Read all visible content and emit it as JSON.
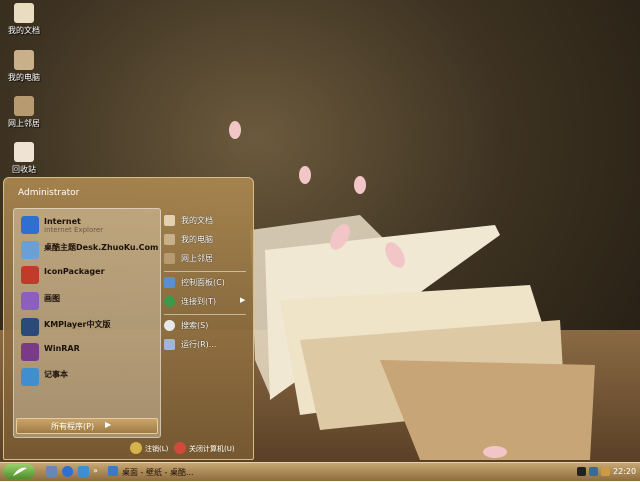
{
  "desktop": {
    "icons": [
      {
        "label": "我的文档",
        "icon": "my-documents-icon"
      },
      {
        "label": "我的电脑",
        "icon": "my-computer-icon"
      },
      {
        "label": "网上邻居",
        "icon": "network-icon"
      },
      {
        "label": "回收站",
        "icon": "recycle-bin-icon"
      }
    ]
  },
  "start_menu": {
    "user": "Administrator",
    "pinned": [
      {
        "name": "Internet",
        "sub": "Internet Explorer",
        "icon": "ie-icon"
      },
      {
        "name": "桌酷主题Desk.ZhuoKu.Com",
        "sub": "",
        "icon": "zhuoku-icon"
      },
      {
        "name": "IconPackager",
        "sub": "",
        "icon": "iconpackager-icon"
      },
      {
        "name": "画图",
        "sub": "",
        "icon": "paint-icon"
      },
      {
        "name": "KMPlayer中文版",
        "sub": "",
        "icon": "kmplayer-icon"
      },
      {
        "name": "WinRAR",
        "sub": "",
        "icon": "winrar-icon"
      },
      {
        "name": "记事本",
        "sub": "",
        "icon": "notepad-icon"
      }
    ],
    "all_programs": "所有程序(P)",
    "right_items": [
      {
        "name": "我的文档",
        "icon": "my-documents-icon"
      },
      {
        "name": "我的电脑",
        "icon": "my-computer-icon"
      },
      {
        "name": "网上邻居",
        "icon": "network-icon"
      },
      {
        "name": "控制面板(C)",
        "icon": "control-panel-icon"
      },
      {
        "name": "连接到(T)",
        "icon": "connect-icon"
      },
      {
        "name": "搜索(S)",
        "icon": "search-icon"
      },
      {
        "name": "运行(R)...",
        "icon": "run-icon"
      }
    ],
    "logoff": "注销(L)",
    "shutdown": "关闭计算机(U)"
  },
  "taskbar": {
    "tasks": [
      {
        "label": "桌面 - 壁纸 - 桌酷..."
      }
    ],
    "clock": "22:20"
  },
  "colors": {
    "accent": "#c7a774",
    "start": "#4f8f2a"
  }
}
